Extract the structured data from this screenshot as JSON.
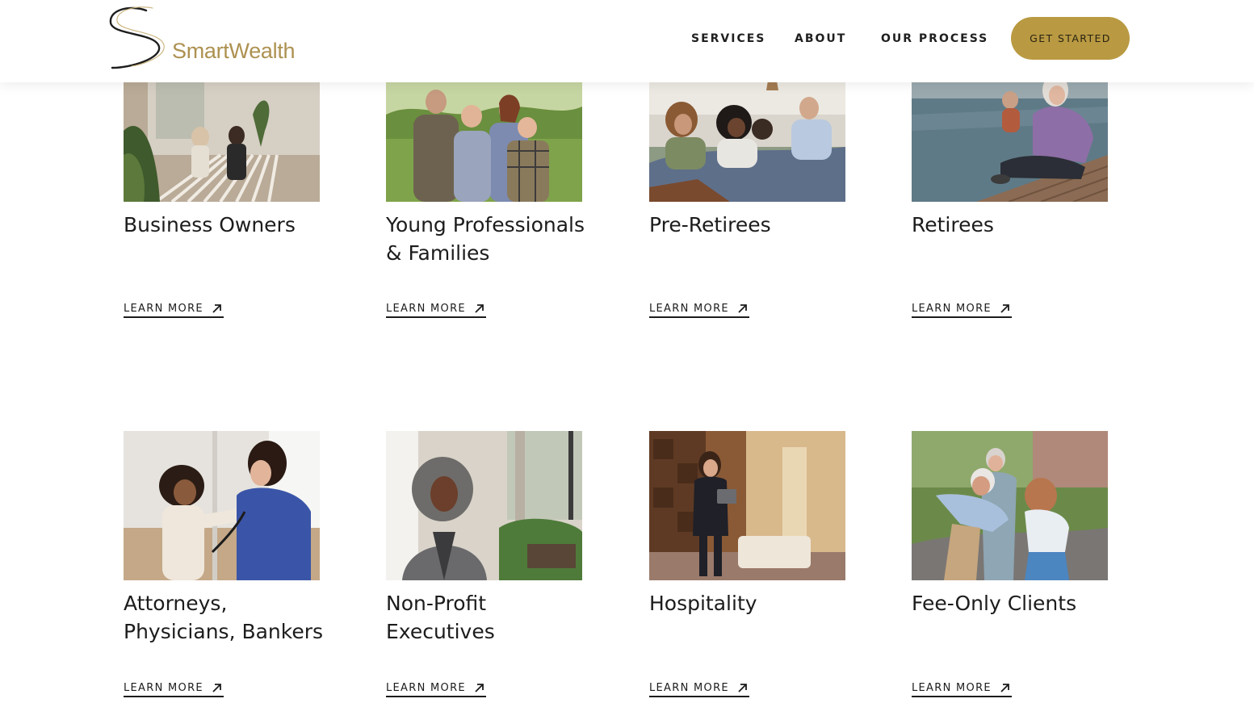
{
  "brand": {
    "name": "SmartWealth",
    "logo_icon": "stylized-s-icon",
    "text_color": "#ad9150"
  },
  "nav": {
    "items": [
      "SERVICES",
      "ABOUT",
      "OUR PROCESS"
    ],
    "cta_label": "GET STARTED",
    "cta_color": "#b99a42"
  },
  "cards": [
    {
      "title": "Business Owners",
      "link_label": "LEARN MORE",
      "link_icon": "arrow-up-right-icon",
      "image": "business-owners-photo"
    },
    {
      "title": "Young Professionals & Families",
      "link_label": "LEARN MORE",
      "link_icon": "arrow-up-right-icon",
      "image": "family-photo"
    },
    {
      "title": "Pre-Retirees",
      "link_label": "LEARN MORE",
      "link_icon": "arrow-up-right-icon",
      "image": "pre-retirees-photo"
    },
    {
      "title": "Retirees",
      "link_label": "LEARN MORE",
      "link_icon": "arrow-up-right-icon",
      "image": "retirees-photo"
    },
    {
      "title": "Attorneys, Physicians, Bankers",
      "link_label": "LEARN MORE",
      "link_icon": "arrow-up-right-icon",
      "image": "physician-photo"
    },
    {
      "title": "Non-Profit Executives",
      "link_label": "LEARN MORE",
      "link_icon": "arrow-up-right-icon",
      "image": "executive-photo"
    },
    {
      "title": "Hospitality",
      "link_label": "LEARN MORE",
      "link_icon": "arrow-up-right-icon",
      "image": "hospitality-photo"
    },
    {
      "title": "Fee-Only Clients",
      "link_label": "LEARN MORE",
      "link_icon": "arrow-up-right-icon",
      "image": "grandparents-photo"
    }
  ]
}
